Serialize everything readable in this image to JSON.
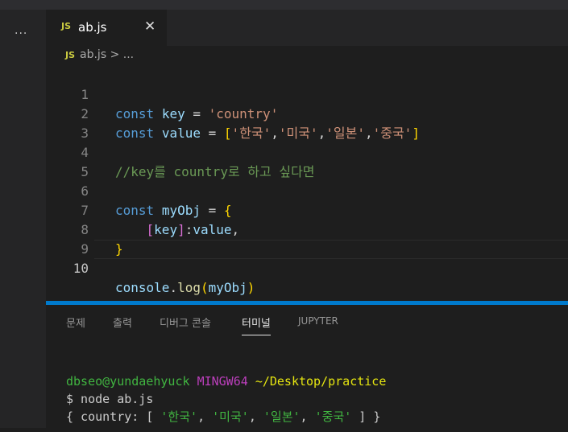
{
  "activity": {
    "more_icon": "···"
  },
  "tab": {
    "icon": "JS",
    "filename": "ab.js",
    "close_icon": "✕"
  },
  "breadcrumb": {
    "icon": "JS",
    "file": "ab.js",
    "separator": ">",
    "more": "..."
  },
  "editor": {
    "line_numbers": [
      "1",
      "2",
      "3",
      "4",
      "5",
      "6",
      "7",
      "8",
      "9",
      "10"
    ],
    "active_line": "10",
    "lines": [
      {
        "kw": "const",
        "name": "key",
        "eq": " = ",
        "str": "'country'"
      },
      {
        "kw": "const",
        "name": "value",
        "eq": " = ",
        "open": "[",
        "items": [
          "'한국'",
          "'미국'",
          "'일본'",
          "'중국'"
        ],
        "close": "]"
      },
      {},
      {
        "comment": "//key를 country로 하고 싶다면"
      },
      {},
      {
        "kw": "const",
        "name": "myObj",
        "eq": " = ",
        "open": "{"
      },
      {
        "indent": "    ",
        "open": "[",
        "key": "key",
        "close": "]",
        "colon": ":",
        "val": "value",
        "comma": ","
      },
      {
        "close": "}"
      },
      {},
      {
        "obj": "console",
        "dot": ".",
        "fn": "log",
        "open": "(",
        "arg": "myObj",
        "close": ")"
      }
    ]
  },
  "panel": {
    "tabs": [
      "문제",
      "출력",
      "디버그 콘솔",
      "터미널",
      "JUPYTER"
    ],
    "active_tab": "터미널",
    "terminal": {
      "user_host": "dbseo@yundaehyuck",
      "env": "MINGW64",
      "path": "~/Desktop/practice",
      "command": "$ node ab.js",
      "output_prefix": "{ country: [ ",
      "output_items": [
        "'한국'",
        "'미국'",
        "'일본'",
        "'중국'"
      ],
      "output_suffix": " ] }"
    }
  },
  "colors": {
    "accent": "#007acc",
    "keyword": "#569cd6",
    "variable": "#9cdcfe",
    "string": "#ce9178",
    "comment": "#6a9955",
    "function": "#dcdcaa"
  }
}
